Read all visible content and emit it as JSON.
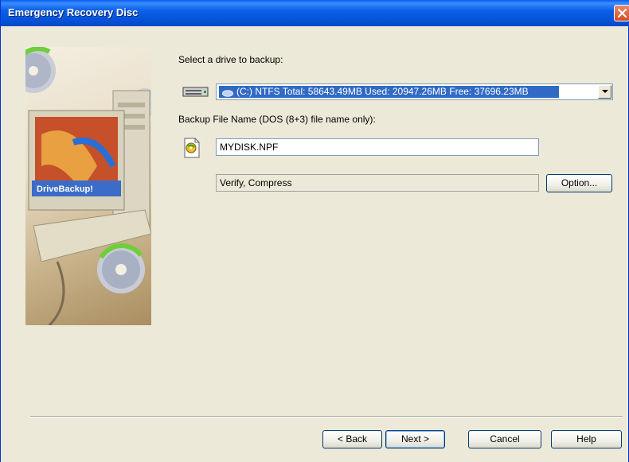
{
  "window": {
    "title": "Emergency Recovery Disc"
  },
  "side_image": {
    "brand_text": "DriveBackup!"
  },
  "drive_section": {
    "label": "Select a drive to backup:",
    "selected_drive": "(C:) NTFS Total: 58643.49MB Used: 20947.26MB Free: 37696.23MB"
  },
  "file_section": {
    "label": "Backup File Name (DOS (8+3) file name only):",
    "file_name": "MYDISK.NPF"
  },
  "options_section": {
    "value": "Verify, Compress",
    "option_button": "Option..."
  },
  "footer": {
    "back": "< Back",
    "next": "Next >",
    "cancel": "Cancel",
    "help": "Help"
  },
  "colors": {
    "titlebar": "#0a5bef",
    "selection": "#316ac5",
    "background": "#ece9d8"
  }
}
